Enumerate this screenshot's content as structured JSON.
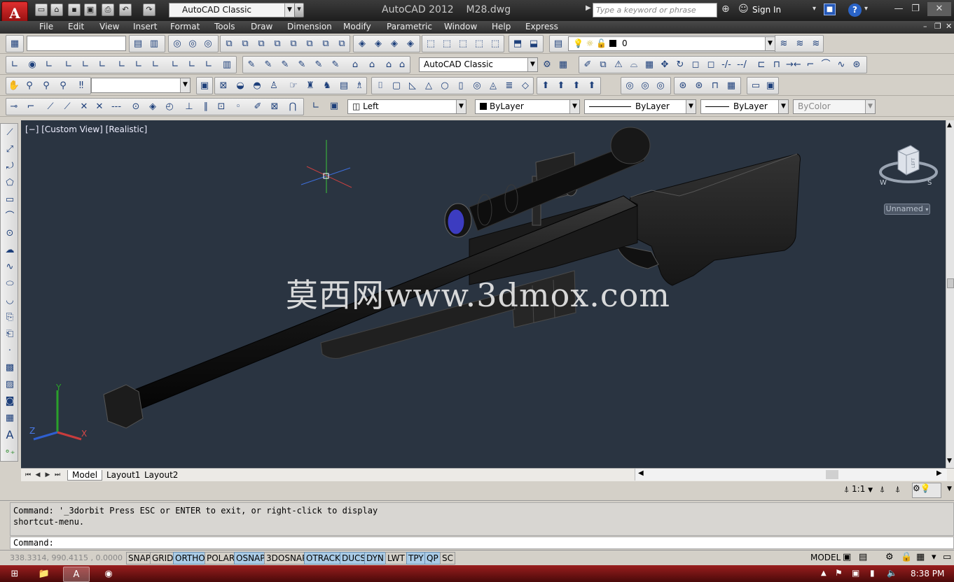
{
  "app": {
    "logo_letter": "A",
    "title_app": "AutoCAD 2012",
    "title_file": "M28.dwg",
    "workspace": "AutoCAD Classic",
    "search_placeholder": "Type a keyword or phrase",
    "sign_in": "Sign In"
  },
  "menu": [
    "File",
    "Edit",
    "View",
    "Insert",
    "Format",
    "Tools",
    "Draw",
    "Dimension",
    "Modify",
    "Parametric",
    "Window",
    "Help",
    "Express"
  ],
  "toolbars": {
    "layer_name": "0",
    "workspace_combo": "AutoCAD Classic",
    "view_combo": "Left",
    "color_combo": "ByLayer",
    "linetype_combo": "ByLayer",
    "lineweight_combo": "ByLayer",
    "plotstyle_combo": "ByColor"
  },
  "viewport": {
    "label": "[−] [Custom View] [Realistic]",
    "watermark": "莫西网www.3dmox.com",
    "viewcube_face": "LEFT",
    "compass": [
      "W",
      "S"
    ],
    "ucs_name": "Unnamed",
    "axis_labels": [
      "Y",
      "Z",
      "X"
    ]
  },
  "layout_tabs": [
    "Model",
    "Layout1",
    "Layout2"
  ],
  "annotation": {
    "scale": "1:1"
  },
  "command": {
    "history": "Command: '_3dorbit Press ESC or ENTER to exit, or right-click to display\nshortcut-menu.",
    "prompt": "Command:"
  },
  "status": {
    "coords": "338.3314, 990.4115 , 0.0000",
    "toggles": [
      {
        "label": "SNAP",
        "on": false
      },
      {
        "label": "GRID",
        "on": false
      },
      {
        "label": "ORTHO",
        "on": true
      },
      {
        "label": "POLAR",
        "on": false
      },
      {
        "label": "OSNAP",
        "on": true
      },
      {
        "label": "3DOSNAP",
        "on": false
      },
      {
        "label": "OTRACK",
        "on": true
      },
      {
        "label": "DUCS",
        "on": true
      },
      {
        "label": "DYN",
        "on": true
      },
      {
        "label": "LWT",
        "on": false
      },
      {
        "label": "TPY",
        "on": true
      },
      {
        "label": "QP",
        "on": true
      },
      {
        "label": "SC",
        "on": false
      }
    ],
    "model": "MODEL"
  },
  "taskbar": {
    "clock": "8:38 PM"
  }
}
